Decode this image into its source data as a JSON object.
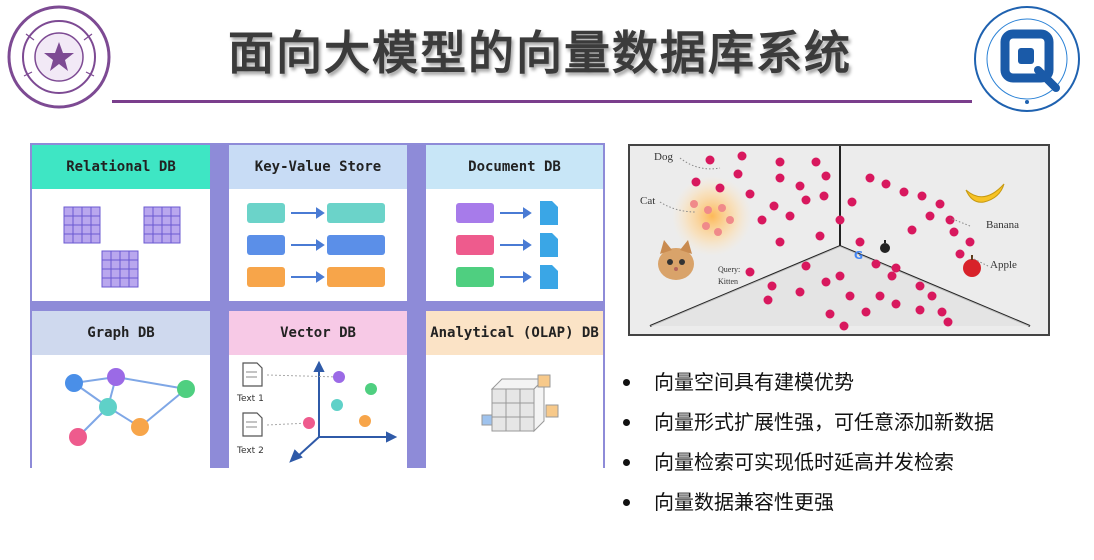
{
  "slide": {
    "title": "面向大模型的向量数据库系统"
  },
  "db_types": [
    {
      "label": "Relational DB",
      "header_color": "#3ee6c4"
    },
    {
      "label": "Key-Value Store",
      "header_color": "#c8dcf5"
    },
    {
      "label": "Document DB",
      "header_color": "#c8e6f7"
    },
    {
      "label": "Graph DB",
      "header_color": "#cfd9ee"
    },
    {
      "label": "Vector DB",
      "header_color": "#f7c9e6"
    },
    {
      "label": "Analytical (OLAP) DB",
      "header_color": "#fbe3c6"
    }
  ],
  "vector_db_panel": {
    "text_1": "Text 1",
    "text_2": "Text 2"
  },
  "vector_space": {
    "labels": {
      "dog": "Dog",
      "cat": "Cat",
      "query": "Query:",
      "query_word": "Kitten",
      "banana": "Banana",
      "apple": "Apple"
    },
    "point_color": "#d8185e"
  },
  "bullets": [
    "向量空间具有建模优势",
    "向量形式扩展性强，可任意添加新数据",
    "向量检索可实现低时延高并发检索",
    "向量数据兼容性更强"
  ]
}
